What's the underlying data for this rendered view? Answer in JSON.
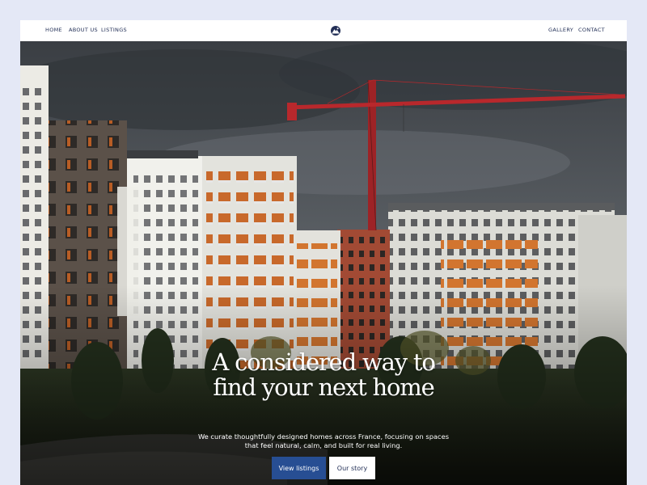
{
  "nav": {
    "left_links": [
      "HOME",
      "ABOUT US",
      "LISTINGS"
    ],
    "right_links": [
      "GALLERY",
      "CONTACT"
    ],
    "logo_icon": "mountain-logo-icon"
  },
  "hero": {
    "headline_line1": "A considered way to",
    "headline_line2": "find your next home",
    "sub_line1": "We curate thoughtfully designed homes across France, focusing on spaces",
    "sub_line2": "that feel natural, calm, and built for real living.",
    "primary_button": "View listings",
    "secondary_button": "Our story"
  },
  "colors": {
    "page_bg": "#e4e8f6",
    "nav_text": "#233057",
    "primary_button": "#274e93",
    "secondary_button_bg": "#ffffff"
  }
}
